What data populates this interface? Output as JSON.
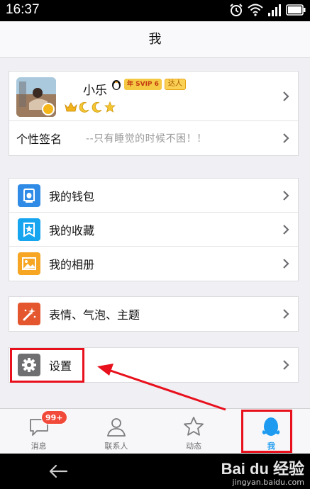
{
  "status_bar": {
    "time": "16:37"
  },
  "title": "我",
  "profile": {
    "nickname": "小乐",
    "svip_badge": "年 SVIP 6",
    "talent_badge": "达人",
    "signature_label": "个性签名",
    "signature_value": "--只有睡觉的时候不困！！"
  },
  "menu_group_1": [
    {
      "label": "我的钱包",
      "icon": "wallet-icon",
      "color": "#2f8be6"
    },
    {
      "label": "我的收藏",
      "icon": "favorites-star-icon",
      "color": "#17a5ef"
    },
    {
      "label": "我的相册",
      "icon": "album-photo-icon",
      "color": "#f6a623"
    }
  ],
  "menu_group_2": [
    {
      "label": "表情、气泡、主题",
      "icon": "magic-wand-icon",
      "color": "#e4572e"
    }
  ],
  "menu_group_3": [
    {
      "label": "设置",
      "icon": "gear-icon",
      "color": "#6f6f72"
    }
  ],
  "tabs": [
    {
      "label": "消息",
      "icon": "chat-bubble-icon",
      "badge": "99+"
    },
    {
      "label": "联系人",
      "icon": "contacts-person-icon"
    },
    {
      "label": "动态",
      "icon": "star-outline-icon"
    },
    {
      "label": "我",
      "icon": "penguin-icon",
      "active": true
    }
  ],
  "watermark": {
    "brand": "Bai du 经验",
    "sub": "jingyan.baidu.com"
  },
  "colors": {
    "accent": "#1e9bf0",
    "annotation": "#e8101c",
    "badge": "#f24a3a"
  }
}
